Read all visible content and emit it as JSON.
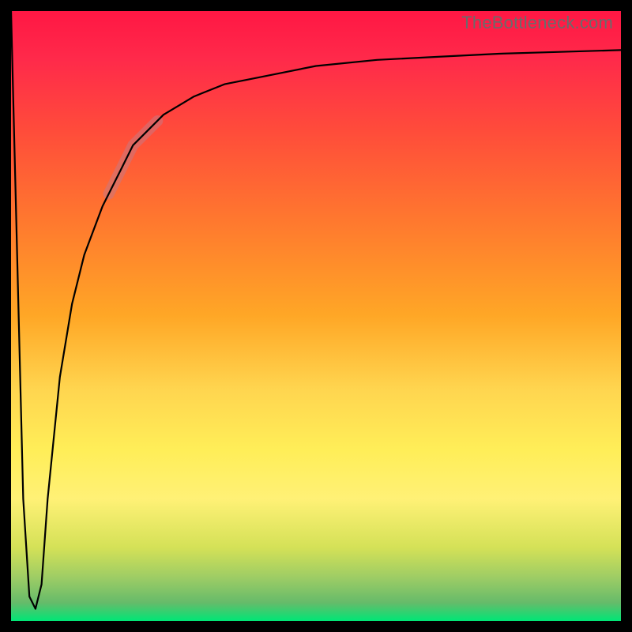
{
  "watermark": "TheBottleneck.com",
  "colors": {
    "frame": "#000000",
    "gradient_top": "#ff1744",
    "gradient_mid": "#ffee58",
    "gradient_bottom": "#00e676",
    "curve": "#000000",
    "highlight": "rgba(200,120,130,0.55)"
  },
  "chart_data": {
    "type": "line",
    "title": "",
    "xlabel": "",
    "ylabel": "",
    "xlim": [
      0,
      100
    ],
    "ylim": [
      0,
      100
    ],
    "series": [
      {
        "name": "bottleneck-curve",
        "x": [
          0,
          1,
          2,
          3,
          4,
          5,
          6,
          8,
          10,
          12,
          15,
          18,
          20,
          25,
          30,
          35,
          40,
          50,
          60,
          70,
          80,
          90,
          100
        ],
        "y": [
          100,
          60,
          20,
          4,
          2,
          6,
          20,
          40,
          52,
          60,
          68,
          74,
          78,
          83,
          86,
          88,
          89,
          91,
          92,
          92.5,
          93,
          93.3,
          93.6
        ]
      }
    ],
    "highlight_segment": {
      "series": "bottleneck-curve",
      "x_start": 16,
      "x_end": 24,
      "note": "pale overlay on ascending part of curve"
    },
    "background_gradient": {
      "orientation": "vertical",
      "stops": [
        {
          "pos": 0.0,
          "color": "#ff1744"
        },
        {
          "pos": 0.5,
          "color": "#ffa726"
        },
        {
          "pos": 0.75,
          "color": "#ffee58"
        },
        {
          "pos": 1.0,
          "color": "#00e676"
        }
      ]
    }
  }
}
